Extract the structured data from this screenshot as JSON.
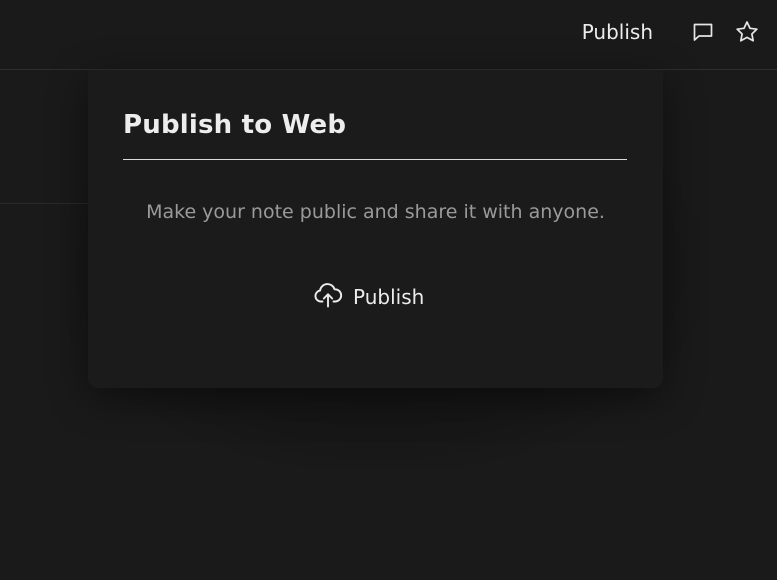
{
  "header": {
    "publish_label": "Publish",
    "comment_icon": "comment-icon",
    "star_icon": "star-icon"
  },
  "popover": {
    "title": "Publish to Web",
    "description": "Make your note public and share it with anyone.",
    "publish_button_label": "Publish",
    "publish_button_icon": "cloud-upload-icon"
  },
  "colors": {
    "background": "#1a1a1a",
    "popover_background": "#1b1b1b",
    "text_primary": "#ececec",
    "text_secondary": "#9a9a9a",
    "divider": "#2e2e2e"
  }
}
